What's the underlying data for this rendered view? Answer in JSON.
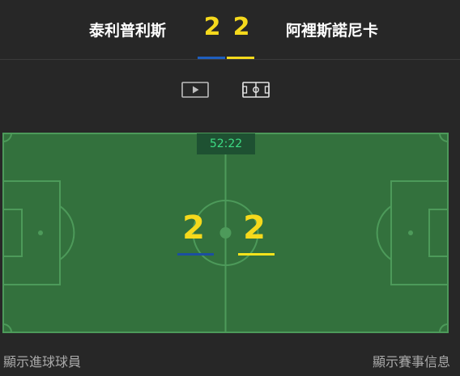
{
  "header": {
    "home_team": "泰利普利斯",
    "away_team": "阿裡斯諾尼卡",
    "home_score": "2",
    "away_score": "2",
    "home_color": "#1f5fbf",
    "away_color": "#f5d91c"
  },
  "view_toggle": {
    "video_icon": "play-video-icon",
    "pitch_icon": "pitch-field-icon",
    "active": "pitch"
  },
  "pitch": {
    "clock": "52:22",
    "home_score": "2",
    "away_score": "2",
    "field_color": "#33713d",
    "line_color": "#4d9a5a"
  },
  "footer": {
    "show_scorers": "顯示進球球員",
    "show_match_info": "顯示賽事信息"
  }
}
